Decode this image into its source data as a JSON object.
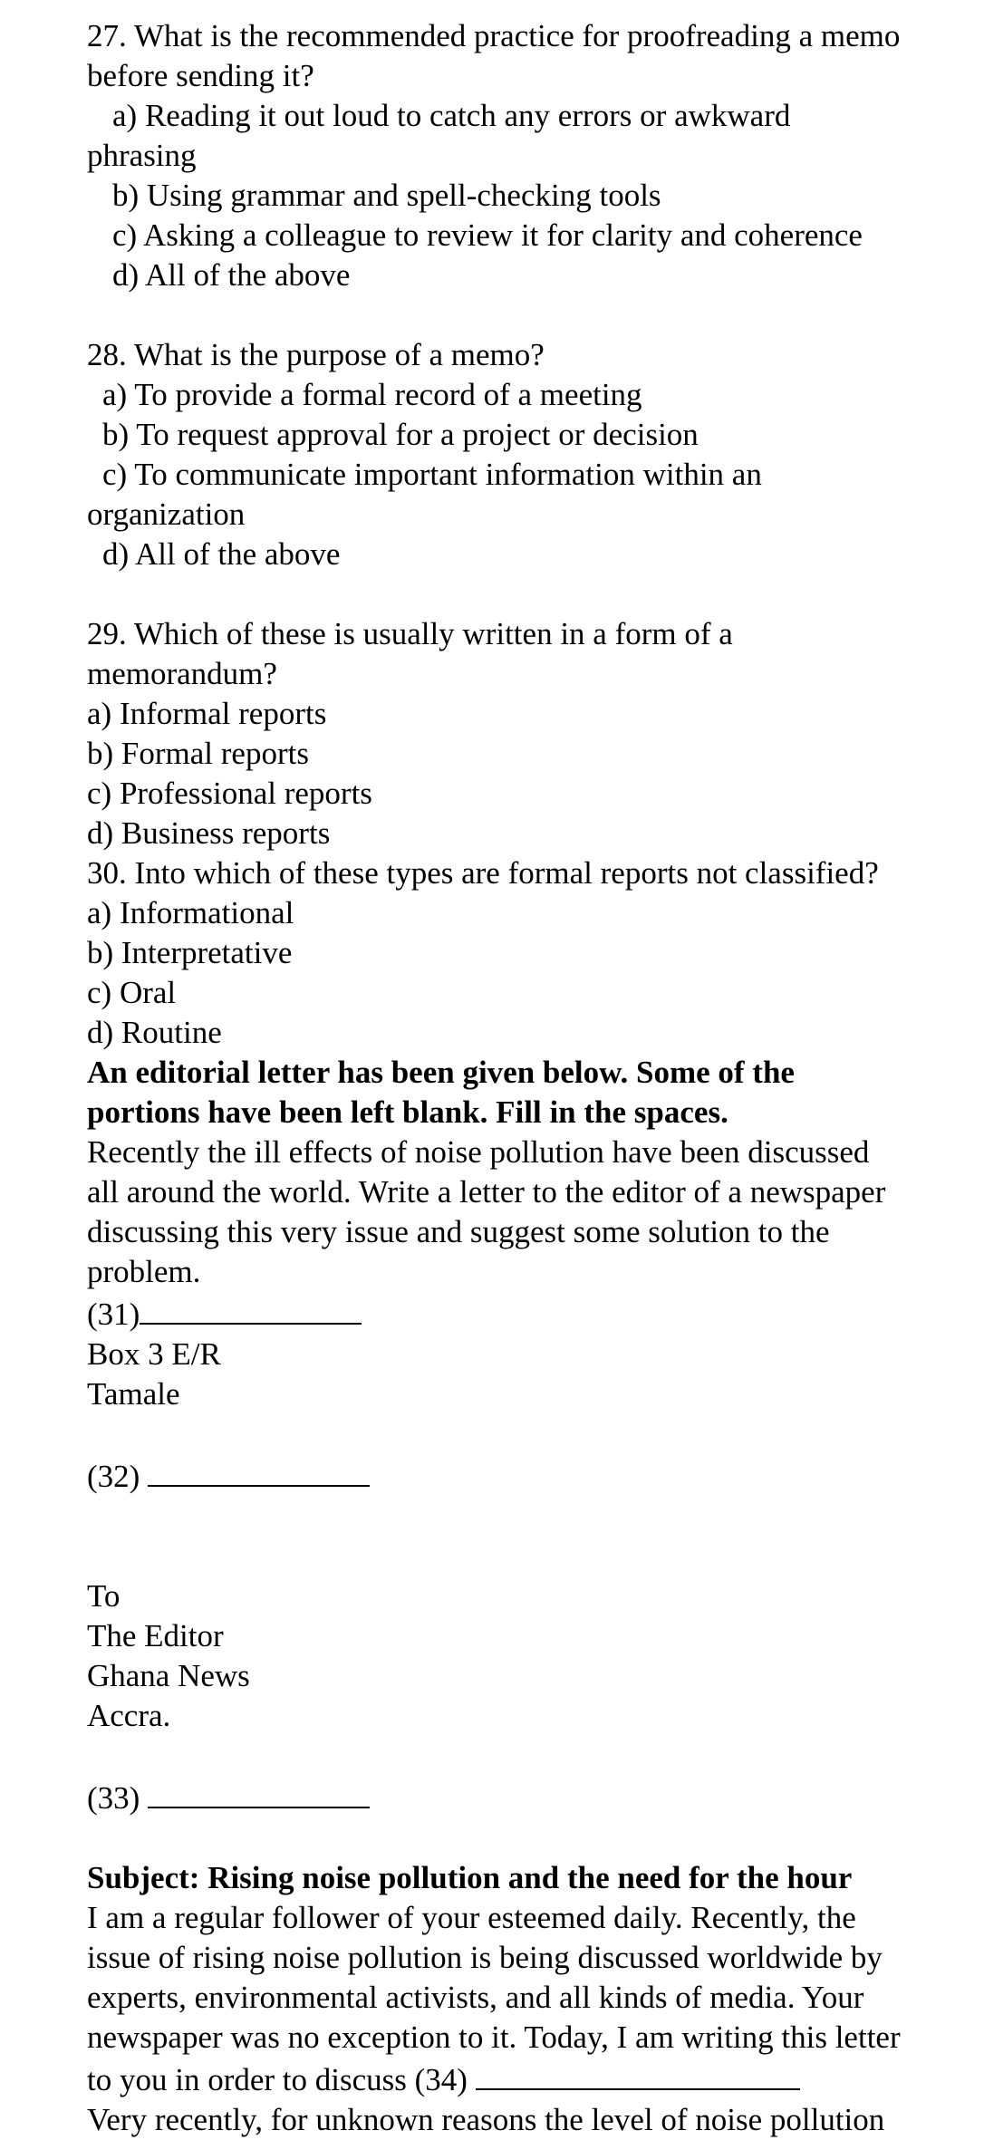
{
  "questions": [
    {
      "number": "27.",
      "text_line1": "27. What is the recommended practice for proofreading a memo",
      "text_line2": "before sending it?",
      "options": [
        {
          "line1": "a) Reading it out loud to catch any errors or awkward",
          "line2": "phrasing"
        },
        {
          "line1": "b) Using grammar and spell-checking tools"
        },
        {
          "line1": "c) Asking a colleague to review it for clarity and coherence"
        },
        {
          "line1": "d) All of the above"
        }
      ]
    },
    {
      "number": "28.",
      "text_line1": "28. What is the purpose of a memo?",
      "options": [
        {
          "line1": "a) To provide a formal record of a meeting"
        },
        {
          "line1": "b) To request approval for a project or decision"
        },
        {
          "line1": "c) To communicate important information within an",
          "line2": "organization"
        },
        {
          "line1": "d) All of the above"
        }
      ]
    },
    {
      "number": "29.",
      "text_line1": "29. Which of these is usually written in a form of a",
      "text_line2": "memorandum?",
      "options": [
        {
          "line1": "a) Informal reports"
        },
        {
          "line1": "b) Formal reports"
        },
        {
          "line1": "c) Professional reports"
        },
        {
          "line1": "d) Business reports"
        }
      ]
    },
    {
      "number": "30.",
      "text_line1": "30. Into which of these types are formal reports not classified?",
      "options": [
        {
          "line1": "a) Informational"
        },
        {
          "line1": "b) Interpretative"
        },
        {
          "line1": "c) Oral"
        },
        {
          "line1": "d) Routine"
        }
      ]
    }
  ],
  "instruction": {
    "line1": "An editorial letter has been given below. Some of the",
    "line2": "portions have been left blank. Fill in the spaces."
  },
  "prompt": {
    "lines": [
      "Recently the ill effects of noise pollution have been discussed",
      "all around the world. Write a letter to the editor of a newspaper",
      "discussing this very issue and suggest some solution to the",
      "problem."
    ]
  },
  "letter": {
    "blank31_label": "(31)",
    "sender_address": [
      "Box 3 E/R",
      "Tamale"
    ],
    "blank32_label": "(32) ",
    "recipient": [
      "To",
      "The Editor",
      "Ghana News",
      "Accra."
    ],
    "blank33_label": "(33) ",
    "subject": "Subject: Rising noise pollution and the need for the hour",
    "body_lines": [
      "I am a regular follower of your esteemed daily. Recently, the",
      "issue of rising noise pollution is being discussed worldwide by",
      "experts, environmental activists, and all kinds of media. Your",
      "newspaper was no exception to it. Today, I am writing this letter"
    ],
    "blank34_prefix": "to you in order to discuss (34) ",
    "continuation_line": "Very recently, for unknown reasons the level of noise pollution"
  }
}
